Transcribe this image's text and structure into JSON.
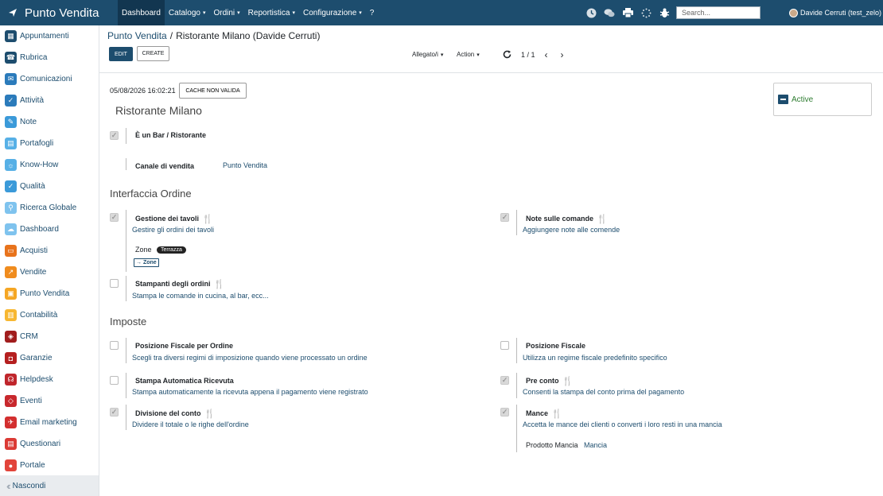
{
  "nav": {
    "brand": "Punto Vendita",
    "menu": [
      {
        "label": "Dashboard",
        "caret": false
      },
      {
        "label": "Catalogo",
        "caret": true
      },
      {
        "label": "Ordini",
        "caret": true
      },
      {
        "label": "Reportistica",
        "caret": true
      },
      {
        "label": "Configurazione",
        "caret": true
      },
      {
        "label": "?",
        "caret": false
      }
    ],
    "caret_glyph": "▾",
    "search_placeholder": "Search...",
    "user": "Davide Cerruti (test_zelo)"
  },
  "sidebar": {
    "items": [
      {
        "label": "Appuntamenti",
        "color": "#1d4d6e",
        "glyph": "▦"
      },
      {
        "label": "Rubrica",
        "color": "#1d4d6e",
        "glyph": "☎"
      },
      {
        "label": "Comunicazioni",
        "color": "#2b7bbb",
        "glyph": "✉"
      },
      {
        "label": "Attività",
        "color": "#2b7bbb",
        "glyph": "✓"
      },
      {
        "label": "Note",
        "color": "#3b9ad9",
        "glyph": "✎"
      },
      {
        "label": "Portafogli",
        "color": "#57b0e6",
        "glyph": "▤"
      },
      {
        "label": "Know-How",
        "color": "#57b0e6",
        "glyph": "☼"
      },
      {
        "label": "Qualità",
        "color": "#3b9ad9",
        "glyph": "✓"
      },
      {
        "label": "Ricerca Globale",
        "color": "#7fc3ee",
        "glyph": "⚲"
      },
      {
        "label": "Dashboard",
        "color": "#7fc3ee",
        "glyph": "☁"
      },
      {
        "label": "Acquisti",
        "color": "#e8731c",
        "glyph": "▭"
      },
      {
        "label": "Vendite",
        "color": "#f08c1e",
        "glyph": "↗"
      },
      {
        "label": "Punto Vendita",
        "color": "#f5a623",
        "glyph": "▣"
      },
      {
        "label": "Contabilità",
        "color": "#f7b731",
        "glyph": "▥"
      },
      {
        "label": "CRM",
        "color": "#a11d1d",
        "glyph": "◈"
      },
      {
        "label": "Garanzie",
        "color": "#b51f1f",
        "glyph": "◘"
      },
      {
        "label": "Helpdesk",
        "color": "#c0262c",
        "glyph": "☊"
      },
      {
        "label": "Eventi",
        "color": "#c8282d",
        "glyph": "◇"
      },
      {
        "label": "Email marketing",
        "color": "#d32f2f",
        "glyph": "✈"
      },
      {
        "label": "Questionari",
        "color": "#db3a34",
        "glyph": "▤"
      },
      {
        "label": "Portale",
        "color": "#e2443a",
        "glyph": "●"
      }
    ],
    "hide_label": "Nascondi"
  },
  "breadcrumb": {
    "parent": "Punto Vendita",
    "separator": "/",
    "current": "Ristorante Milano (Davide Cerruti)"
  },
  "toolbar": {
    "edit": "EDIT",
    "create": "CREATE",
    "attachment": "Allegato/i",
    "action": "Action",
    "pager": "1 / 1"
  },
  "form": {
    "date": "05/08/2026 16:02:21",
    "cache_button": "CACHE NON VALIDA",
    "name": "Ristorante Milano",
    "status": "Active",
    "is_bar": {
      "label": "È un Bar / Ristorante",
      "checked": true
    },
    "channel": {
      "label": "Canale di vendita",
      "value": "Punto Vendita"
    },
    "interface_title": "Interfaccia Ordine",
    "table_management": {
      "label": "Gestione dei tavoli",
      "desc": "Gestire gli ordini dei tavoli",
      "checked": true
    },
    "zones_label": "Zone",
    "zones_tag": "Terrazza",
    "zones_button": "→ Zone",
    "order_notes": {
      "label": "Note sulle comande",
      "desc": "Aggiungere note alle comende",
      "checked": true
    },
    "printers": {
      "label": "Stampanti degli ordini",
      "desc": "Stampa le comande in cucina, al bar, ecc...",
      "checked": false
    },
    "taxes_title": "Imposte",
    "fiscal_per_order": {
      "label": "Posizione Fiscale per Ordine",
      "desc": "Scegli tra diversi regimi di imposizione quando viene processato un ordine",
      "checked": false
    },
    "fiscal_position": {
      "label": "Posizione Fiscale",
      "desc": "Utilizza un regime fiscale predefinito specifico",
      "checked": false
    },
    "auto_receipt": {
      "label": "Stampa Automatica Ricevuta",
      "desc": "Stampa automaticamente la ricevuta appena il pagamento viene registrato",
      "checked": false
    },
    "pre_bill": {
      "label": "Pre conto",
      "desc": "Consenti la stampa del conto prima del pagamento",
      "checked": true
    },
    "split_bill": {
      "label": "Divisione del conto",
      "desc": "Dividere il totale o le righe dell'ordine",
      "checked": true
    },
    "tips": {
      "label": "Mance",
      "desc": "Accetta le mance dei clienti o converti i loro resti in una mancia",
      "checked": true
    },
    "tip_product": {
      "label": "Prodotto Mancia",
      "value": "Mancia"
    }
  }
}
